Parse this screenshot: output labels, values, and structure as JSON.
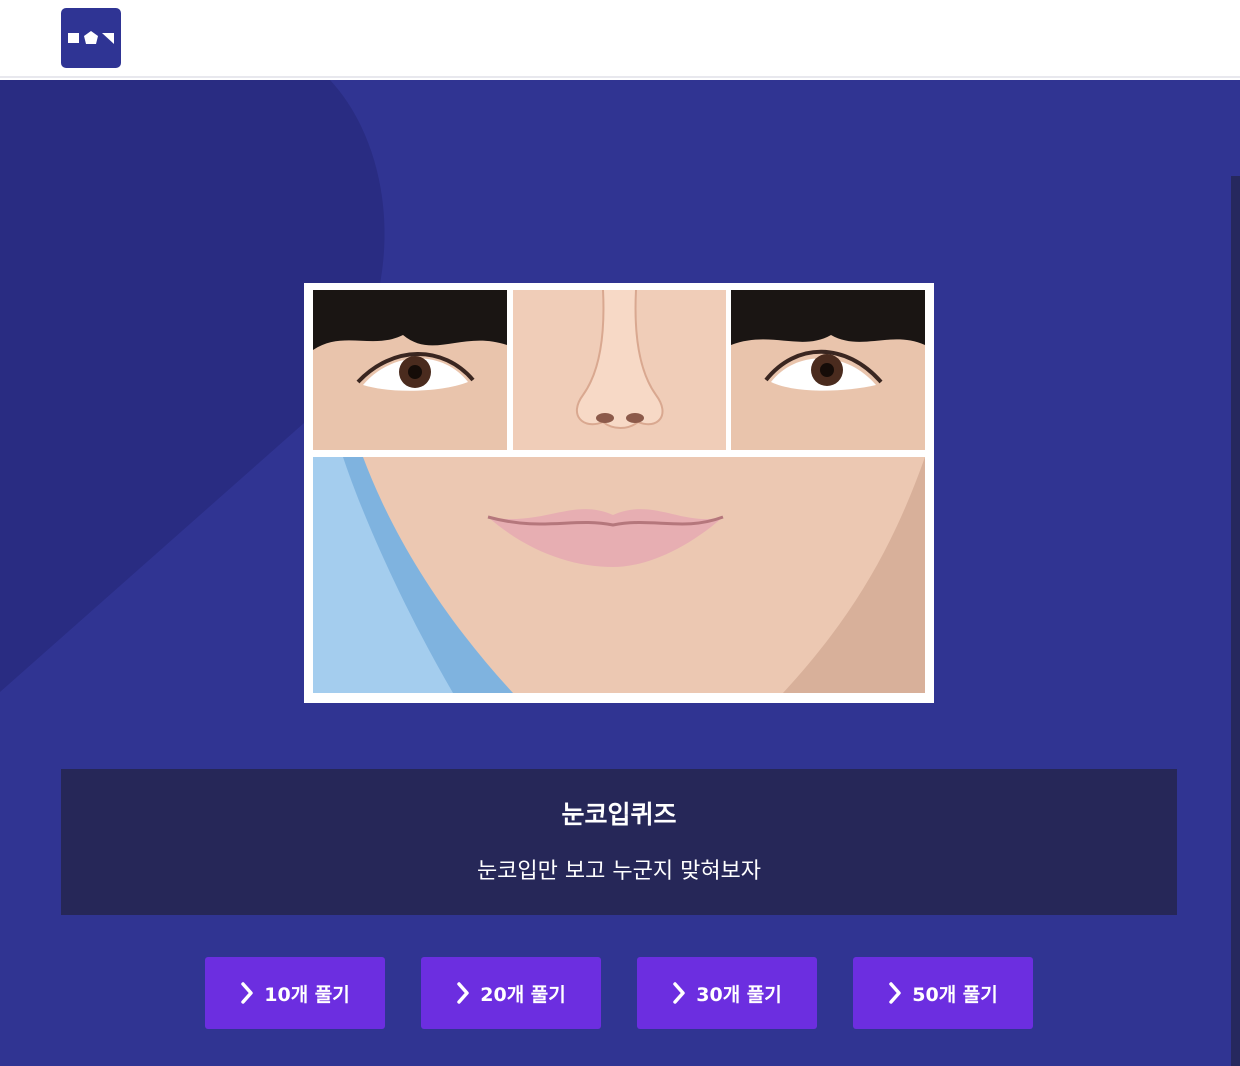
{
  "header": {
    "logo_icon": "site-logo-icon"
  },
  "quiz": {
    "image_icon": "face-parts-collage",
    "title": "눈코입퀴즈",
    "subtitle": "눈코입만 보고 누군지 맞혀보자"
  },
  "buttons": [
    {
      "label": "10개 풀기",
      "icon": "chevron-right-icon"
    },
    {
      "label": "20개 풀기",
      "icon": "chevron-right-icon"
    },
    {
      "label": "30개 풀기",
      "icon": "chevron-right-icon"
    },
    {
      "label": "50개 풀기",
      "icon": "chevron-right-icon"
    }
  ],
  "colors": {
    "background": "#303492",
    "info_panel": "#262758",
    "button": "#6c2ee0",
    "logo": "#2f3494"
  }
}
